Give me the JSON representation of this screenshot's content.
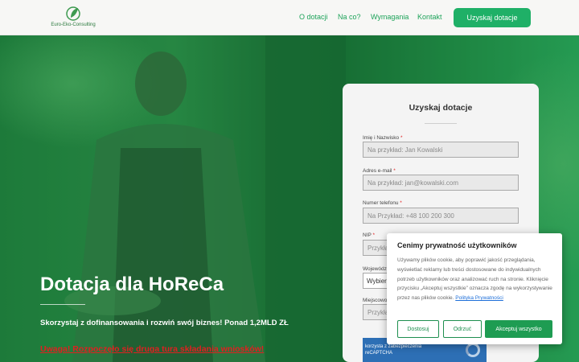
{
  "header": {
    "logo_text": "Euro-Eko-Consulting",
    "nav": [
      {
        "label": "O dotacji"
      },
      {
        "label": "Na co?"
      },
      {
        "label": "Wymagania"
      },
      {
        "label": "Kontakt"
      }
    ],
    "cta_label": "Uzyskaj dotacje"
  },
  "hero": {
    "title": "Dotacja dla HoReCa",
    "subtitle": "Skorzystaj z dofinansowania i rozwiń swój biznes! Ponad 1,2MLD ZŁ",
    "warning": "Uwaga! Rozpoczęło się druga tura składania wniosków!"
  },
  "form": {
    "title": "Uzyskaj dotacje",
    "fields": [
      {
        "label": "Imię i Nazwisko",
        "required": "*",
        "placeholder": "Na przykład: Jan Kowalski"
      },
      {
        "label": "Adres e-mail",
        "required": "*",
        "placeholder": "Na przykład: jan@kowalski.com"
      },
      {
        "label": "Numer telefonu",
        "required": "*",
        "placeholder": "Na Przykład: +48 100 200 300"
      },
      {
        "label": "NIP",
        "required": "*",
        "placeholder": "Przykła"
      },
      {
        "label": "Województwo",
        "value": "Wybier"
      },
      {
        "label": "Miejscowość",
        "placeholder": "Przykła"
      }
    ],
    "recaptcha_line1": "korzysta z zabezpieczenia",
    "recaptcha_line2": "reCAPTCHA"
  },
  "cookie": {
    "title": "Cenimy prywatność użytkowników",
    "text": "Używamy plików cookie, aby poprawić jakość przeglądania, wyświetlać reklamy lub treści dostosowane do indywidualnych potrzeb użytkowników oraz analizować ruch na stronie. Kliknięcie przycisku „Akceptuj wszystkie” oznacza zgodę na wykorzystywanie przez nas plików cookie.",
    "link_text": "Polityka Prywatności",
    "buttons": {
      "customize": "Dostosuj",
      "reject": "Odrzuć",
      "accept": "Akceptuj wszystko"
    }
  },
  "colors": {
    "accent": "#1fb067",
    "hero_green": "#1b6e35",
    "warning": "#e02020"
  }
}
